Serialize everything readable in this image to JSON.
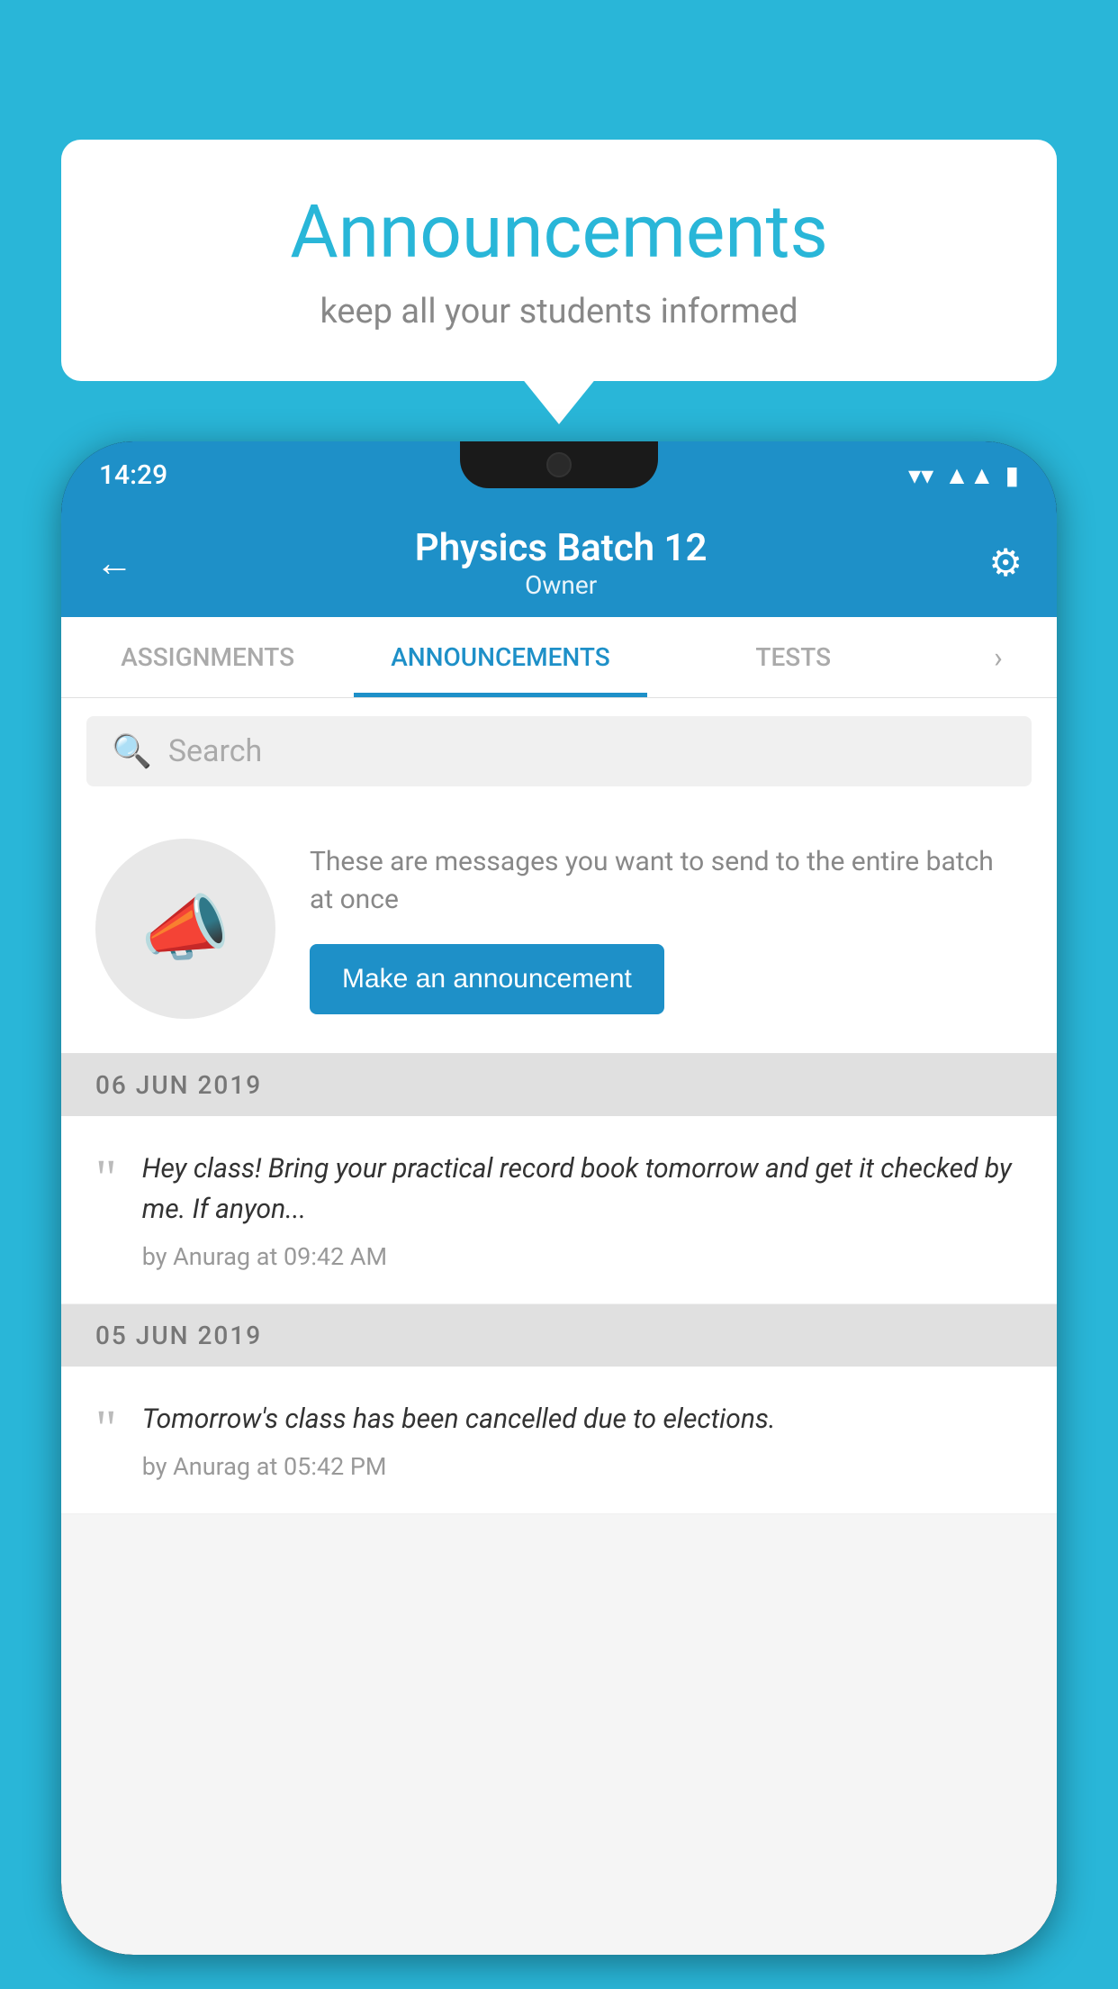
{
  "background_color": "#29b6d8",
  "speech_bubble": {
    "title": "Announcements",
    "subtitle": "keep all your students informed"
  },
  "phone": {
    "status_bar": {
      "time": "14:29",
      "icons": [
        "wifi",
        "signal",
        "battery"
      ]
    },
    "app_bar": {
      "title": "Physics Batch 12",
      "subtitle": "Owner",
      "back_label": "←",
      "settings_label": "⚙"
    },
    "tabs": [
      {
        "label": "ASSIGNMENTS",
        "active": false
      },
      {
        "label": "ANNOUNCEMENTS",
        "active": true
      },
      {
        "label": "TESTS",
        "active": false
      }
    ],
    "search": {
      "placeholder": "Search"
    },
    "cta": {
      "description": "These are messages you want to send to the entire batch at once",
      "button_label": "Make an announcement"
    },
    "announcements": [
      {
        "date_header": "06  JUN  2019",
        "text": "Hey class! Bring your practical record book tomorrow and get it checked by me. If anyon...",
        "author": "by Anurag at 09:42 AM"
      },
      {
        "date_header": "05  JUN  2019",
        "text": "Tomorrow's class has been cancelled due to elections.",
        "author": "by Anurag at 05:42 PM"
      }
    ]
  }
}
